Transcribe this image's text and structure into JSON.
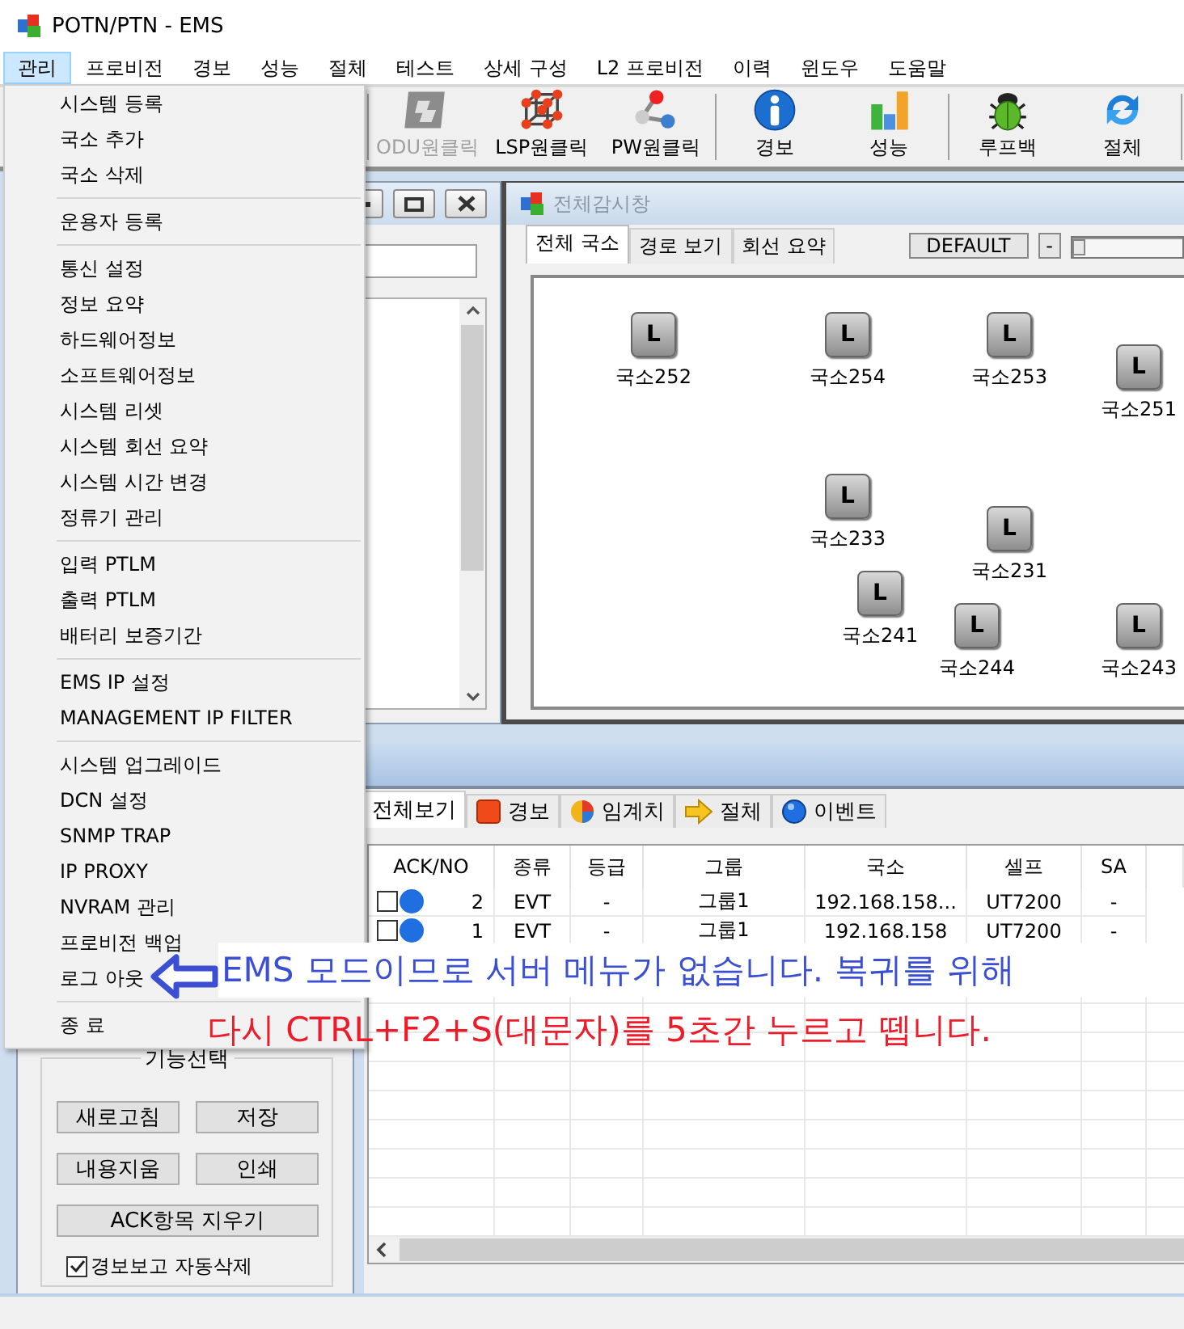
{
  "window": {
    "title": "POTN/PTN - EMS"
  },
  "menu_bar": [
    {
      "label": "관리",
      "selected": true
    },
    {
      "label": "프로비전",
      "selected": false
    },
    {
      "label": "경보",
      "selected": false
    },
    {
      "label": "성능",
      "selected": false
    },
    {
      "label": "절체",
      "selected": false
    },
    {
      "label": "테스트",
      "selected": false
    },
    {
      "label": "상세 구성",
      "selected": false
    },
    {
      "label": "L2 프로비전",
      "selected": false
    },
    {
      "label": "이력",
      "selected": false
    },
    {
      "label": "윈도우",
      "selected": false
    },
    {
      "label": "도움말",
      "selected": false
    }
  ],
  "dropdown_menu": {
    "groups": [
      {
        "items": [
          "시스템 등록",
          "국소 추가",
          "국소 삭제"
        ]
      },
      {
        "items": [
          "운용자 등록"
        ]
      },
      {
        "items": [
          "통신 설정",
          "정보 요약",
          "하드웨어정보",
          "소프트웨어정보",
          "시스템 리셋",
          "시스템 회선 요약",
          "시스템 시간 변경",
          "정류기 관리"
        ]
      },
      {
        "items": [
          "입력 PTLM",
          "출력 PTLM",
          "배터리 보증기간"
        ]
      },
      {
        "items": [
          "EMS IP 설정",
          "MANAGEMENT IP FILTER"
        ]
      },
      {
        "items": [
          "시스템 업그레이드",
          "DCN 설정",
          "SNMP TRAP",
          "IP PROXY",
          "NVRAM 관리",
          "프로비전 백업",
          "로그 아웃"
        ]
      },
      {
        "items": [
          "종 료"
        ]
      }
    ]
  },
  "toolbar": {
    "groups": [
      {
        "buttons": [
          {
            "label": "ODU원클릭",
            "kind": "odu",
            "disabled": true
          },
          {
            "label": "LSP원클릭",
            "kind": "lsp",
            "disabled": false
          },
          {
            "label": "PW원클릭",
            "kind": "pw",
            "disabled": false
          }
        ]
      },
      {
        "buttons": [
          {
            "label": "경보",
            "kind": "alarm",
            "disabled": false
          },
          {
            "label": "성능",
            "kind": "performance",
            "disabled": false
          }
        ]
      },
      {
        "buttons": [
          {
            "label": "루프백",
            "kind": "loopback",
            "disabled": false
          },
          {
            "label": "절체",
            "kind": "switch",
            "disabled": false
          }
        ]
      }
    ]
  },
  "monitor_window": {
    "title": "전체감시창",
    "tabs": [
      {
        "label": "전체 국소",
        "selected": true
      },
      {
        "label": "경로 보기",
        "selected": false
      },
      {
        "label": "회선 요약",
        "selected": false
      }
    ],
    "profile_button": "DEFAULT",
    "zoom_out_button": "-",
    "zoom_slider": {
      "level": 0
    },
    "nodes": [
      {
        "label": "국소252",
        "badge": "L"
      },
      {
        "label": "국소254",
        "badge": "L"
      },
      {
        "label": "국소253",
        "badge": "L"
      },
      {
        "label": "국소251",
        "badge": "L"
      },
      {
        "label": "국소233",
        "badge": "L"
      },
      {
        "label": "국소231",
        "badge": "L"
      },
      {
        "label": "국소241",
        "badge": "L"
      },
      {
        "label": "국소244",
        "badge": "L"
      },
      {
        "label": "국소243",
        "badge": "L"
      }
    ]
  },
  "left_panel": {
    "group_title": "기능선택",
    "buttons": [
      "새로고침",
      "저장",
      "내용지움",
      "인쇄",
      "ACK항목 지우기"
    ],
    "checkbox": {
      "label": "경보보고 자동삭제",
      "checked": true
    }
  },
  "alarm_panel": {
    "tabs": [
      {
        "label": "전체보기",
        "kind": "all",
        "selected": true
      },
      {
        "label": "경보",
        "kind": "alarm",
        "selected": false
      },
      {
        "label": "임계치",
        "kind": "threshold",
        "selected": false
      },
      {
        "label": "절체",
        "kind": "switch",
        "selected": false
      },
      {
        "label": "이벤트",
        "kind": "event",
        "selected": false
      }
    ],
    "columns": [
      "ACK/NO",
      "종류",
      "등급",
      "그룹",
      "국소",
      "셀프",
      "SA"
    ],
    "rows": [
      {
        "checked": false,
        "color": "#1f6fe0",
        "cells": [
          "2",
          "EVT",
          "-",
          "그룹1",
          "192.168.158...",
          "UT7200",
          "-"
        ]
      },
      {
        "checked": false,
        "color": "#1f6fe0",
        "cells": [
          "1",
          "EVT",
          "-",
          "그룹1",
          "192.168.158",
          "UT7200",
          "-"
        ]
      }
    ]
  },
  "annotation": {
    "lines": [
      {
        "text": "EMS 모드이므로 서버 메뉴가 없습니다. 복귀를 위해",
        "color": "#3b4fd2",
        "boxed": true
      },
      {
        "text": "다시 CTRL+F2+S(대문자)를 5초간 누르고 뗍니다.",
        "color": "#ec1c2a",
        "boxed": false
      }
    ]
  }
}
